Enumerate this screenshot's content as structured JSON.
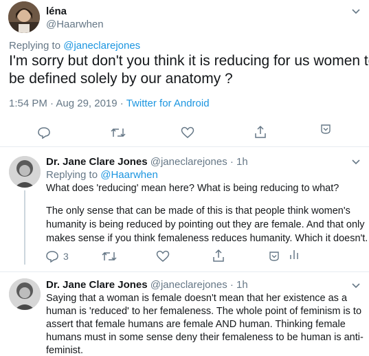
{
  "main_tweet": {
    "name": "léna",
    "handle": "@Haarwhen",
    "replying_prefix": "Replying to",
    "replying_to": "@janeclarejones",
    "text_line1": "I'm sorry but don't you think it is reducing for us women to",
    "text_line2": "be defined solely by our anatomy ?",
    "time": "1:54 PM · Aug 29, 2019 ·",
    "source": "Twitter for Android",
    "actions": [
      "reply-icon",
      "retweet-icon",
      "like-icon",
      "share-icon",
      "caret-down-icon"
    ]
  },
  "reply1": {
    "name": "Dr. Jane Clare Jones",
    "handle_time": "@janeclarejones · 1h",
    "replying_prefix": "Replying to",
    "replying_to": "@Haarwhen",
    "p1": "What does 'reducing' mean here? What is being reducing to what?",
    "p2_line1": "The only sense that can be made of this is that people think women's",
    "p2_line2": "humanity is being reduced by pointing out they are female. And that only",
    "p2_line3": "makes sense if you think femaleness reduces humanity. Which it doesn't.",
    "reply_count": "3",
    "actions": [
      "reply-icon",
      "retweet-icon",
      "like-icon",
      "share-icon",
      "caret-down-icon",
      "analytics-icon"
    ]
  },
  "reply2": {
    "name": "Dr. Jane Clare Jones",
    "handle_time": "@janeclarejones · 1h",
    "line1": "Saying that a woman is female doesn't mean that her existence as a",
    "line2": "human is 'reduced' to her femaleness. The whole point of feminism is to",
    "line3": "assert that female humans are female AND human. Thinking female",
    "line4": "humans must in some sense deny their femaleness to be human is anti-",
    "line5": "feminist."
  },
  "colors": {
    "accent": "#1b95e0",
    "muted": "#657786",
    "divider": "#e6ecf0",
    "thread_line": "#ccd6dd"
  }
}
